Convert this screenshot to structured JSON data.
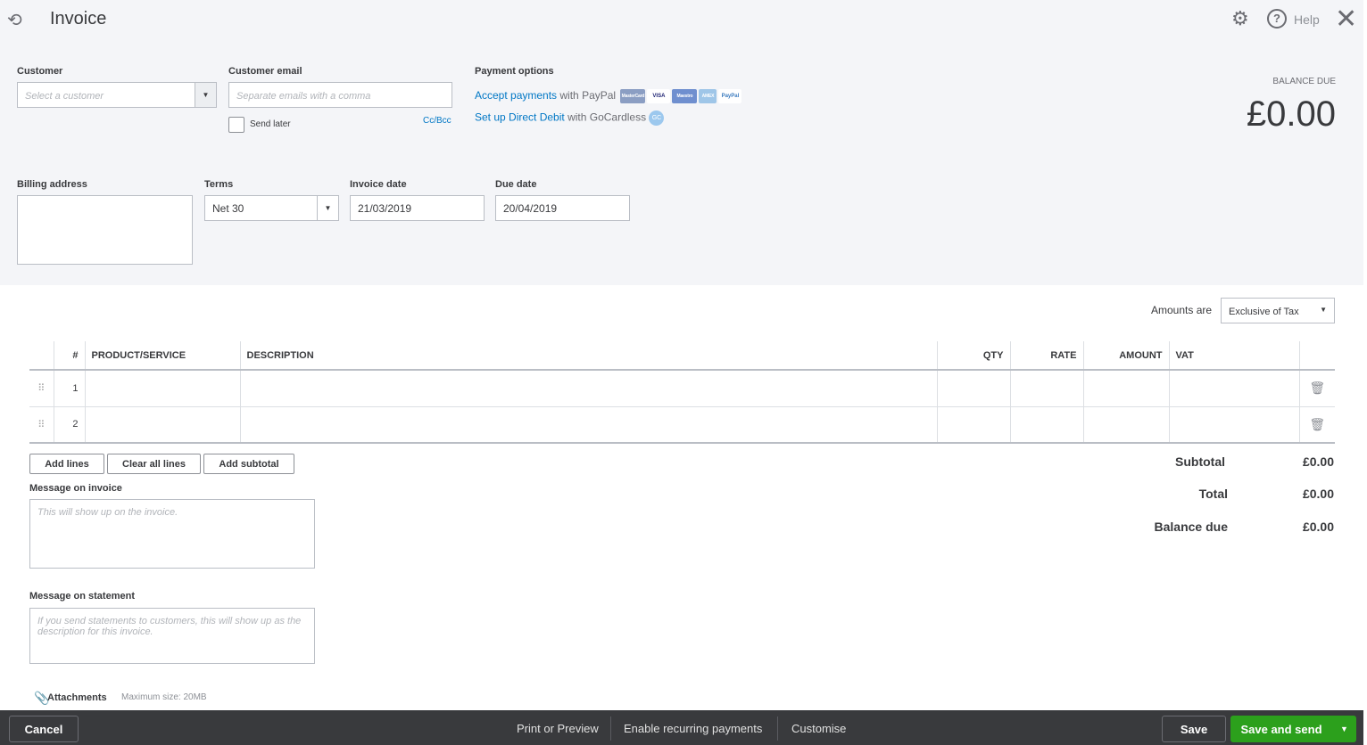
{
  "header": {
    "title": "Invoice",
    "help": "Help"
  },
  "customer": {
    "label": "Customer",
    "placeholder": "Select a customer"
  },
  "email": {
    "label": "Customer email",
    "placeholder": "Separate emails with a comma",
    "send_later": "Send later",
    "cc_bcc": "Cc/Bcc"
  },
  "payment": {
    "label": "Payment options",
    "paypal_link": "Accept payments",
    "paypal_suffix": "with PayPal",
    "gc_link": "Set up Direct Debit",
    "gc_suffix": "with GoCardless",
    "cards": [
      "MasterCard",
      "VISA",
      "Maestro",
      "AMEX",
      "PayPal"
    ],
    "gc_badge": "GC"
  },
  "balance": {
    "label": "BALANCE DUE",
    "amount": "£0.00"
  },
  "billing": {
    "label": "Billing address"
  },
  "terms": {
    "label": "Terms",
    "value": "Net 30"
  },
  "invoice_date": {
    "label": "Invoice date",
    "value": "21/03/2019"
  },
  "due_date": {
    "label": "Due date",
    "value": "20/04/2019"
  },
  "amounts": {
    "label": "Amounts are",
    "value": "Exclusive of Tax"
  },
  "table": {
    "headers": [
      "#",
      "PRODUCT/SERVICE",
      "DESCRIPTION",
      "QTY",
      "RATE",
      "AMOUNT",
      "VAT"
    ],
    "rows": [
      "1",
      "2"
    ]
  },
  "buttons": {
    "add_lines": "Add lines",
    "clear": "Clear all lines",
    "subtotal": "Add subtotal"
  },
  "totals": {
    "subtotal_label": "Subtotal",
    "subtotal": "£0.00",
    "total_label": "Total",
    "total": "£0.00",
    "balance_label": "Balance due",
    "balance": "£0.00"
  },
  "message_invoice": {
    "label": "Message on invoice",
    "placeholder": "This will show up on the invoice."
  },
  "message_statement": {
    "label": "Message on statement",
    "placeholder": "If you send statements to customers, this will show up as the description for this invoice."
  },
  "attachments": {
    "label": "Attachments",
    "max": "Maximum size: 20MB"
  },
  "footer": {
    "cancel": "Cancel",
    "print": "Print or Preview",
    "recurring": "Enable recurring payments",
    "customise": "Customise",
    "save": "Save",
    "save_send": "Save and send"
  }
}
